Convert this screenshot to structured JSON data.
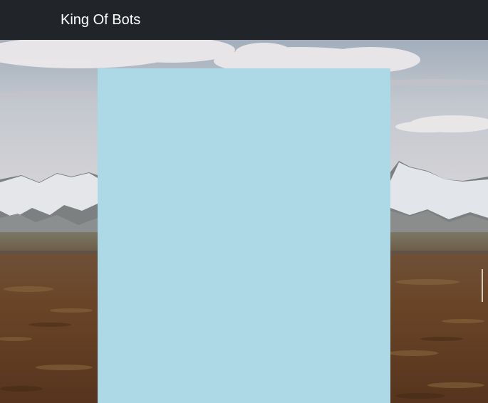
{
  "navbar": {
    "brand": "King Of Bots"
  },
  "background": {
    "image": "landscape-mountains-desert",
    "colors": {
      "sky_top": "#a9b4c0",
      "sky_bottom": "#cdd0d6",
      "cloud": "#e9e6e7",
      "snow": "#e6e8ec",
      "rock": "#7d7f80",
      "plain": "#6f583e",
      "ground": "#5a3a22"
    }
  },
  "content_panel": {
    "color": "#add8e6"
  }
}
